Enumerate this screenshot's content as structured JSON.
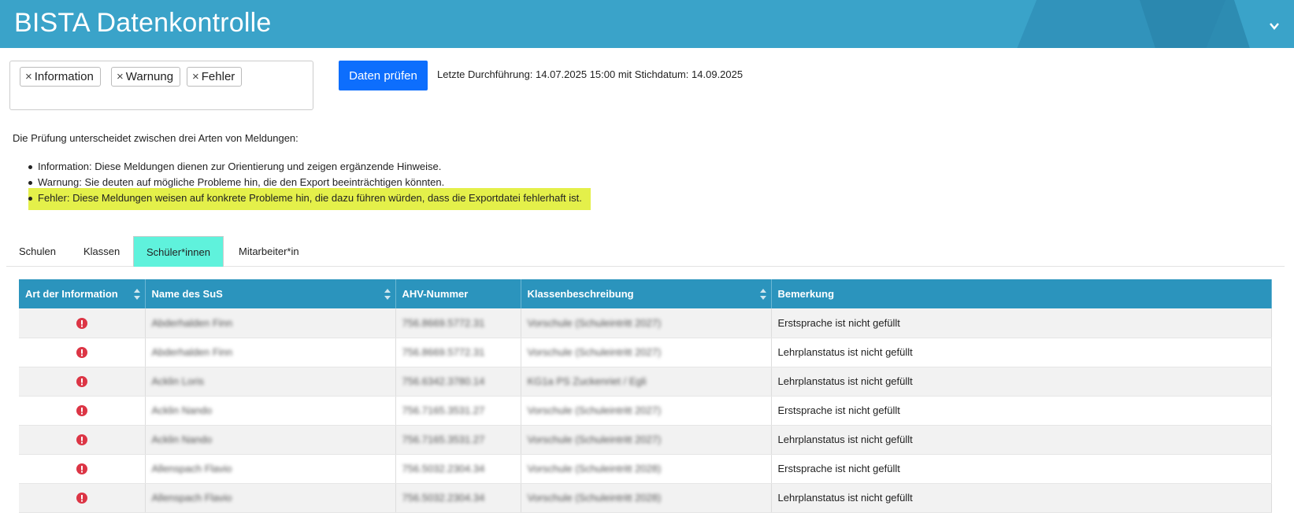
{
  "header": {
    "title": "BISTA Datenkontrolle",
    "chevron_icon": "chevron-down-icon"
  },
  "filters": {
    "chips": [
      "Information",
      "Warnung",
      "Fehler"
    ],
    "remove_icon": "close-icon"
  },
  "actions": {
    "check_button": "Daten prüfen",
    "last_run": "Letzte Durchführung: 14.07.2025 15:00 mit Stichdatum: 14.09.2025"
  },
  "intro": "Die Prüfung unterscheidet zwischen drei Arten von Meldungen:",
  "legend": [
    "Information: Diese Meldungen dienen zur Orientierung und zeigen ergänzende Hinweise.",
    "Warnung: Sie deuten auf mögliche Probleme hin, die den Export beeinträchtigen könnten.",
    "Fehler: Diese Meldungen weisen auf konkrete Probleme hin, die dazu führen würden, dass die Exportdatei fehlerhaft ist."
  ],
  "tabs": [
    "Schulen",
    "Klassen",
    "Schüler*innen",
    "Mitarbeiter*in"
  ],
  "active_tab": "Schüler*innen",
  "colors": {
    "header": "#3aa3c9",
    "table_header": "#2b94bd",
    "button": "#0d6efd",
    "active_tab": "#5ff2dc",
    "highlight": "#e4f04a",
    "error": "#dc3545"
  },
  "table": {
    "columns": [
      "Art der Information",
      "Name des SuS",
      "AHV-Nummer",
      "Klassenbeschreibung",
      "Bemerkung"
    ],
    "rows": [
      {
        "type_icon": "error-icon",
        "name": "Abderhalden Finn",
        "ahv": "756.8669.5772.31",
        "class": "Vorschule (Schuleintritt 2027)",
        "remark": "Erstsprache ist nicht gefüllt"
      },
      {
        "type_icon": "error-icon",
        "name": "Abderhalden Finn",
        "ahv": "756.8669.5772.31",
        "class": "Vorschule (Schuleintritt 2027)",
        "remark": "Lehrplanstatus ist nicht gefüllt"
      },
      {
        "type_icon": "error-icon",
        "name": "Acklin Loris",
        "ahv": "756.6342.3780.14",
        "class": "KG1a PS Zuckenriet / Egli",
        "remark": "Lehrplanstatus ist nicht gefüllt"
      },
      {
        "type_icon": "error-icon",
        "name": "Acklin Nando",
        "ahv": "756.7165.3531.27",
        "class": "Vorschule (Schuleintritt 2027)",
        "remark": "Erstsprache ist nicht gefüllt"
      },
      {
        "type_icon": "error-icon",
        "name": "Acklin Nando",
        "ahv": "756.7165.3531.27",
        "class": "Vorschule (Schuleintritt 2027)",
        "remark": "Lehrplanstatus ist nicht gefüllt"
      },
      {
        "type_icon": "error-icon",
        "name": "Allenspach Flavio",
        "ahv": "756.5032.2304.34",
        "class": "Vorschule (Schuleintritt 2028)",
        "remark": "Erstsprache ist nicht gefüllt"
      },
      {
        "type_icon": "error-icon",
        "name": "Allenspach Flavio",
        "ahv": "756.5032.2304.34",
        "class": "Vorschule (Schuleintritt 2028)",
        "remark": "Lehrplanstatus ist nicht gefüllt"
      }
    ]
  }
}
